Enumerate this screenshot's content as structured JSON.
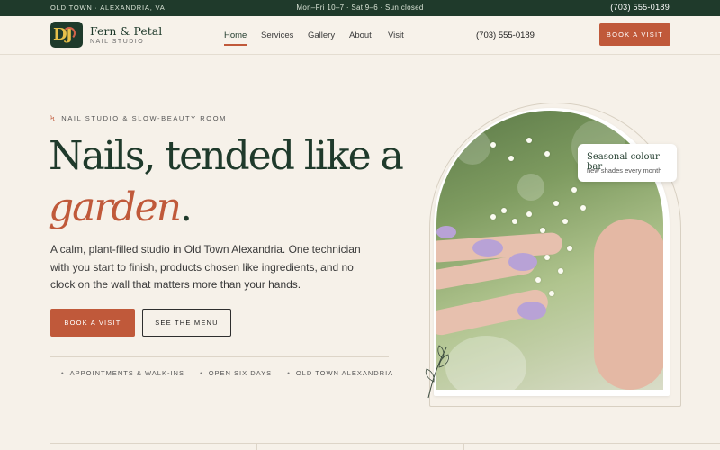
{
  "topbar": {
    "location": "OLD TOWN · ALEXANDRIA, VA",
    "hours": "Mon–Fri 10–7 · Sat 9–6 · Sun closed",
    "phone": "(703) 555-0189"
  },
  "header": {
    "logo_text": "DJ",
    "brand_name": "Fern & Petal",
    "brand_sub": "NAIL STUDIO",
    "nav": [
      "Home",
      "Services",
      "Gallery",
      "About",
      "Visit"
    ],
    "active_nav": "Home",
    "phone": "(703) 555-0189",
    "cta_label": "BOOK A VISIT"
  },
  "hero": {
    "eyebrow": "NAIL STUDIO & SLOW-BEAUTY ROOM",
    "headline_line1": "Nails, tended like a",
    "headline_accent": "garden",
    "headline_end": ".",
    "lede": "A calm, plant-filled studio in Old Town Alexandria. One technician with you start to finish, products chosen like ingredients, and no clock on the wall that matters more than your hands.",
    "primary_cta": "BOOK A VISIT",
    "secondary_cta": "SEE THE MENU",
    "tags": [
      "APPOINTMENTS & WALK-INS",
      "OPEN SIX DAYS",
      "OLD TOWN ALEXANDRIA"
    ]
  },
  "badge": {
    "title": "Seasonal colour bar",
    "subtitle": "new shades every month"
  },
  "colors": {
    "brand_green": "#1f3a2b",
    "accent_terracotta": "#c0593a",
    "background": "#f6f1e9"
  }
}
